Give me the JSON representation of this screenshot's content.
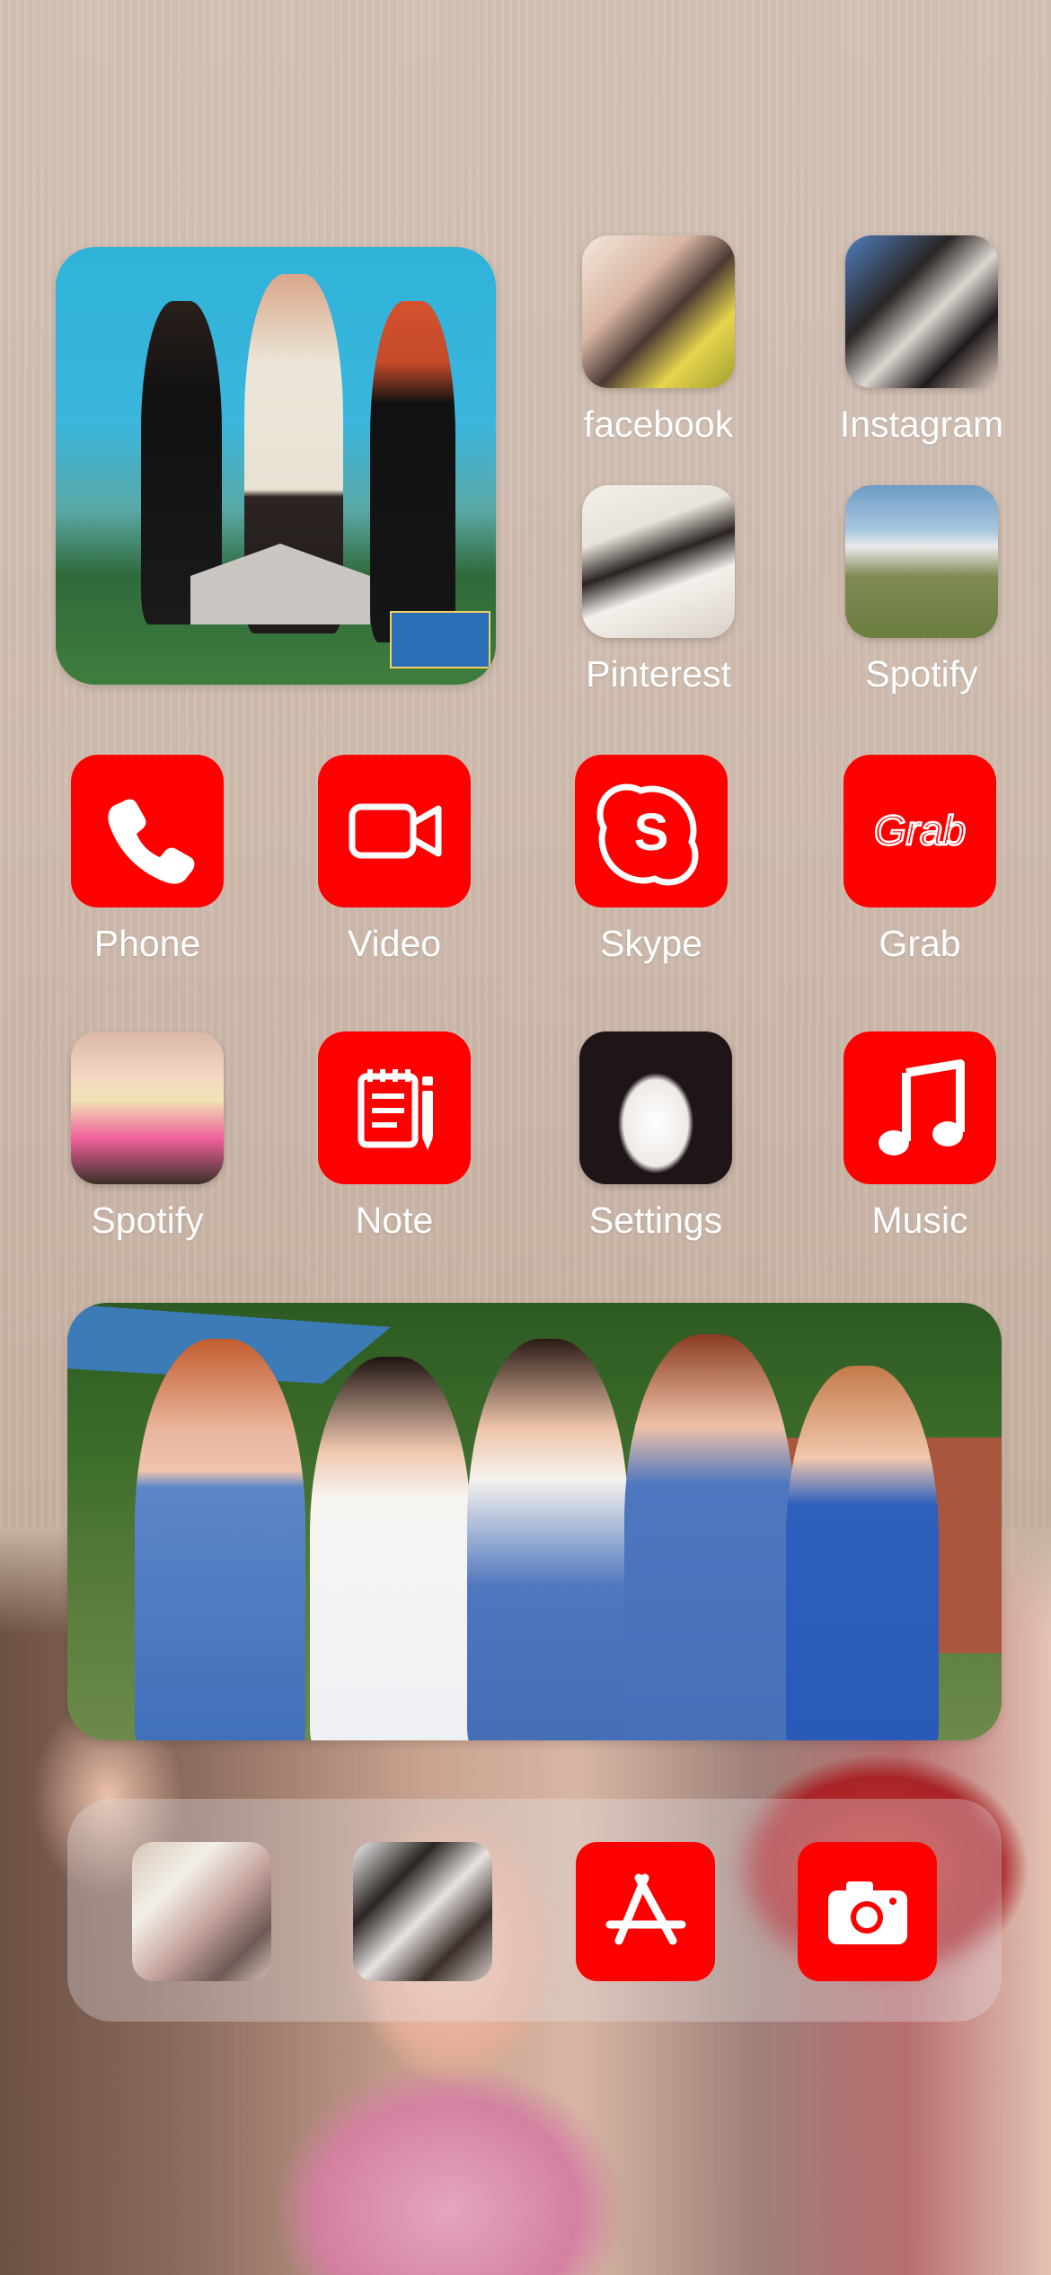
{
  "apps": {
    "facebook": "facebook",
    "instagram": "Instagram",
    "pinterest": "Pinterest",
    "spotify_top": "Spotify",
    "phone": "Phone",
    "video": "Video",
    "skype": "Skype",
    "grab": "Grab",
    "spotify_mid": "Spotify",
    "note": "Note",
    "settings": "Settings",
    "music": "Music"
  },
  "grab_logo_text": "Grab",
  "icons": {
    "phone": "phone-icon",
    "video": "video-camera-icon",
    "skype": "skype-icon",
    "grab": "grab-logo-icon",
    "note": "notepad-icon",
    "music": "music-note-icon",
    "app_store": "app-store-icon",
    "camera": "camera-icon"
  },
  "colors": {
    "accent_red": "#fe0000",
    "label_white": "#ffffff"
  }
}
